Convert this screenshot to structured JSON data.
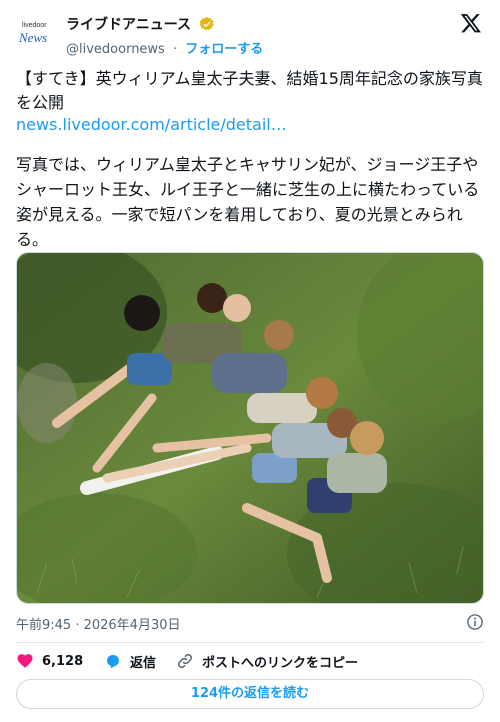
{
  "account": {
    "display_name": "ライブドアニュース",
    "handle": "@livedoornews",
    "separator": "·",
    "follow_label": "フォローする",
    "avatar_small": "livedoor",
    "avatar_brand": "News"
  },
  "post": {
    "title": "【すてき】英ウィリアム皇太子夫妻、結婚15周年記念の家族写真を公開",
    "link_text": "news.livedoor.com/article/detail…",
    "body": "写真では、ウィリアム皇太子とキャサリン妃が、ジョージ王子やシャーロット王女、ルイ王子と一緒に芝生の上に横たわっている姿が見える。一家で短パンを着用しており、夏の光景とみられる。",
    "timestamp": "午前9:45 · 2026年4月30日"
  },
  "actions": {
    "like_count": "6,128",
    "reply_label": "返信",
    "copy_link_label": "ポストへのリンクをコピー",
    "read_replies_label": "124件の返信を読む"
  },
  "colors": {
    "accent": "#1d9bf0",
    "like": "#f91880",
    "verified": "#e2b719"
  },
  "icons": [
    "verified-badge-icon",
    "x-logo-icon",
    "info-icon",
    "heart-icon",
    "reply-icon",
    "link-icon"
  ]
}
